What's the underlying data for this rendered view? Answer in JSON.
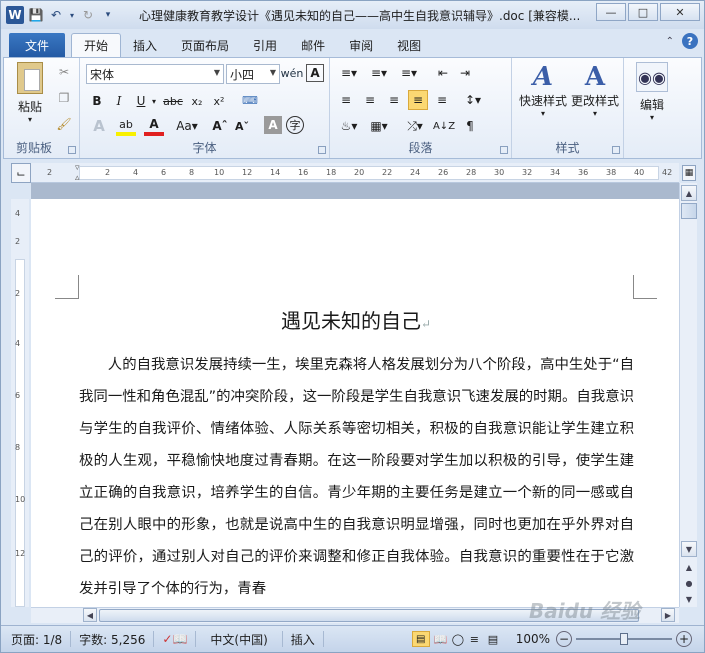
{
  "window": {
    "app_icon": "W",
    "title": "心理健康教育教学设计《遇见未知的自己——高中生自我意识辅导》.doc [兼容模..."
  },
  "tabs": {
    "file": "文件",
    "items": [
      "开始",
      "插入",
      "页面布局",
      "引用",
      "邮件",
      "审阅",
      "视图"
    ]
  },
  "ribbon": {
    "clipboard": {
      "paste": "粘贴",
      "label": "剪贴板"
    },
    "font": {
      "name": "宋体",
      "size": "小四",
      "label": "字体"
    },
    "paragraph": {
      "label": "段落"
    },
    "styles": {
      "quick": "快速样式",
      "change": "更改样式",
      "label": "样式"
    },
    "editing": {
      "label": "编辑"
    }
  },
  "ruler": {
    "h_ticks": [
      "2",
      "2",
      "4",
      "6",
      "8",
      "10",
      "12",
      "14",
      "16",
      "18",
      "20",
      "22",
      "24",
      "26",
      "28",
      "30",
      "32",
      "34",
      "36",
      "38",
      "40",
      "42"
    ],
    "v_ticks": [
      "4",
      "2",
      "2",
      "4",
      "6",
      "8",
      "10",
      "12"
    ]
  },
  "document": {
    "title": "遇见未知的自己",
    "paragraph": "人的自我意识发展持续一生，埃里克森将人格发展划分为八个阶段，高中生处于“自我同一性和角色混乱”的冲突阶段，这一阶段是学生自我意识飞速发展的时期。自我意识与学生的自我评价、情绪体验、人际关系等密切相关，积极的自我意识能让学生建立积极的人生观，平稳愉快地度过青春期。在这一阶段要对学生加以积极的引导，使学生建立正确的自我意识，培养学生的自信。青少年期的主要任务是建立一个新的同一感或自己在别人眼中的形象，也就是说高中生的自我意识明显增强，同时也更加在乎外界对自己的评价，通过别人对自己的评价来调整和修正自我体验。自我意识的重要性在于它激发并引导了个体的行为，青春"
  },
  "status": {
    "page": "页面: 1/8",
    "words": "字数: 5,256",
    "lang": "中文(中国)",
    "mode": "插入",
    "zoom": "100%"
  },
  "watermark": "Baidu 经验",
  "colors": {
    "accent": "#2b5797",
    "ribbon_bg": "#e4ecf7"
  }
}
